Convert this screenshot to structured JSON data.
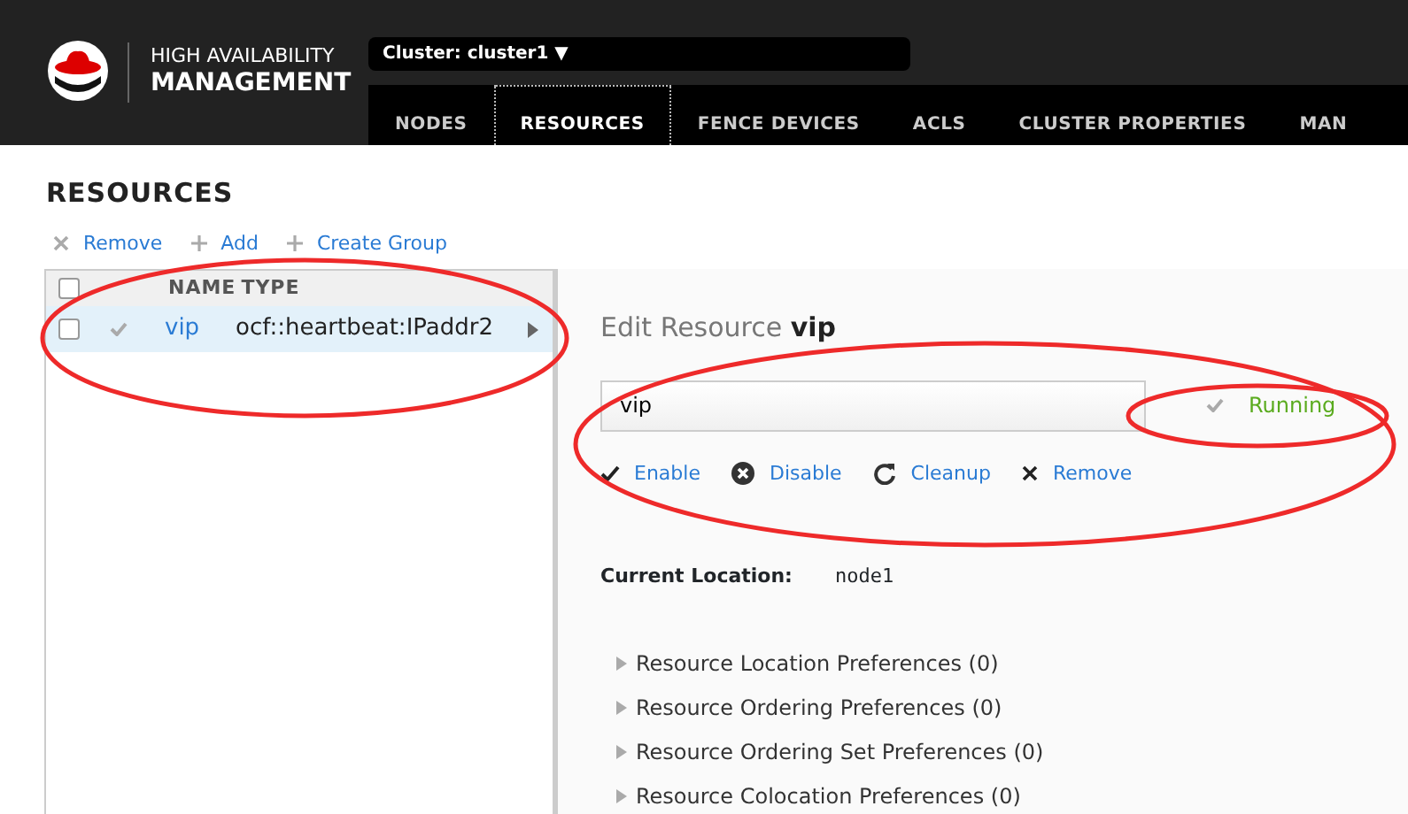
{
  "header": {
    "product_line_1": "HIGH AVAILABILITY",
    "product_line_2": "MANAGEMENT",
    "cluster_selector": "Cluster: cluster1 ▼"
  },
  "nav_tabs": [
    {
      "label": "NODES",
      "selected": false
    },
    {
      "label": "RESOURCES",
      "selected": true
    },
    {
      "label": "FENCE DEVICES",
      "selected": false
    },
    {
      "label": "ACLS",
      "selected": false
    },
    {
      "label": "CLUSTER PROPERTIES",
      "selected": false
    },
    {
      "label": "MAN",
      "selected": false
    }
  ],
  "page_title": "RESOURCES",
  "toolbar": [
    {
      "kind": "remove",
      "label": "Remove"
    },
    {
      "kind": "add",
      "label": "Add"
    },
    {
      "kind": "add",
      "label": "Create Group"
    }
  ],
  "resource_table": {
    "circled": true,
    "all_checked": false,
    "columns": [
      "NAME",
      "TYPE"
    ],
    "rows": [
      {
        "name": "vip",
        "type": "ocf::heartbeat:IPaddr2",
        "checked": false,
        "selected": true,
        "running": true
      }
    ]
  },
  "editor": {
    "heading": "Edit Resource **vip**",
    "circled": true,
    "name_value": "vip",
    "status": {
      "label": "Running",
      "circled": true
    },
    "actions": [
      {
        "kind": "enable",
        "label": "Enable"
      },
      {
        "kind": "disable",
        "label": "Disable"
      },
      {
        "kind": "cleanup",
        "label": "Cleanup"
      },
      {
        "kind": "remove",
        "label": "Remove"
      }
    ],
    "location_label": "Current Location:",
    "location_value": "node1",
    "sections": [
      {
        "label": "Resource Location Preferences (0)",
        "expanded": false
      },
      {
        "label": "Resource Ordering Preferences (0)",
        "expanded": false
      },
      {
        "label": "Resource Ordering Set Preferences (0)",
        "expanded": false
      },
      {
        "label": "Resource Colocation Preferences (0)",
        "expanded": false
      }
    ]
  }
}
